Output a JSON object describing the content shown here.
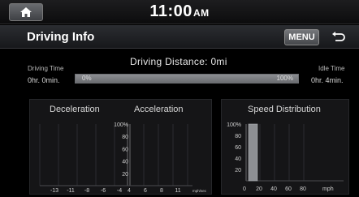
{
  "status_bar": {
    "time": "11:00",
    "ampm": "AM"
  },
  "header": {
    "title": "Driving Info",
    "menu_label": "MENU"
  },
  "driving_time": {
    "label": "Driving Time",
    "value": "0hr. 0min."
  },
  "idle_time": {
    "label": "Idle Time",
    "value": "0hr. 4min."
  },
  "distance": {
    "label": "Driving Distance:",
    "value": "0mi"
  },
  "ratio_bar": {
    "left_label": "0%",
    "right_label": "100%",
    "fill_fraction": 1.0
  },
  "accel_panel": {
    "decel_title": "Deceleration",
    "accel_title": "Acceleration",
    "y_ticks": [
      "100%",
      "80",
      "60",
      "40",
      "20"
    ],
    "decel_ticks": [
      "-13",
      "-11",
      "-8",
      "-6",
      "-4"
    ],
    "accel_ticks": [
      "4",
      "6",
      "8",
      "11"
    ],
    "unit": "mph/sec"
  },
  "speed_panel": {
    "title": "Speed Distribution",
    "y_ticks": [
      "100%",
      "80",
      "60",
      "40",
      "20"
    ],
    "x_ticks": [
      "0",
      "20",
      "40",
      "60",
      "80"
    ],
    "unit": "mph"
  },
  "chart_data": [
    {
      "type": "bar",
      "title": "Speed Distribution",
      "categories": [
        "0-20",
        "20-40",
        "40-60",
        "60-80",
        "80+"
      ],
      "values": [
        100,
        0,
        0,
        0,
        0
      ],
      "xlabel": "mph",
      "ylabel": "",
      "ylim": [
        0,
        100
      ]
    }
  ],
  "colors": {
    "background": "#000000",
    "bar_fill": "#7a7c80",
    "speed_bar": "#8d8f93"
  }
}
